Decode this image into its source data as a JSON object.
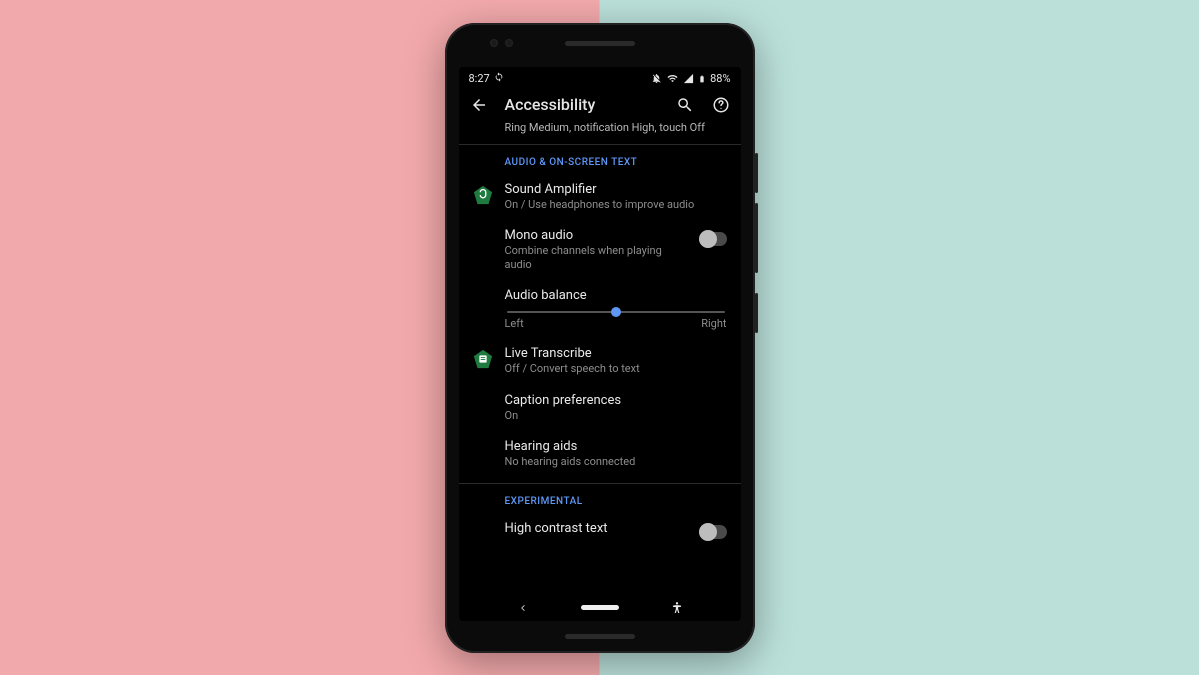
{
  "status": {
    "time": "8:27",
    "battery": "88%"
  },
  "header": {
    "title": "Accessibility",
    "subtitle": "Ring Medium, notification High, touch Off"
  },
  "sections": {
    "audio": {
      "label": "AUDIO & ON-SCREEN TEXT",
      "sound_amp": {
        "title": "Sound Amplifier",
        "sub": "On / Use headphones to improve audio"
      },
      "mono": {
        "title": "Mono audio",
        "sub": "Combine channels when playing audio"
      },
      "balance": {
        "title": "Audio balance",
        "left": "Left",
        "right": "Right"
      },
      "live_transcribe": {
        "title": "Live Transcribe",
        "sub": "Off / Convert speech to text"
      },
      "captions": {
        "title": "Caption preferences",
        "sub": "On"
      },
      "hearing": {
        "title": "Hearing aids",
        "sub": "No hearing aids connected"
      }
    },
    "experimental": {
      "label": "EXPERIMENTAL",
      "high_contrast": {
        "title": "High contrast text"
      }
    }
  }
}
